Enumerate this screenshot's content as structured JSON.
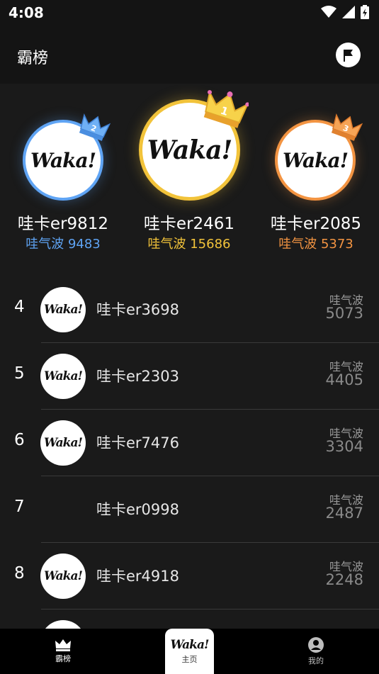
{
  "status_bar": {
    "time": "4:08"
  },
  "header": {
    "title": "霸榜"
  },
  "logo_text": "Waka!",
  "top3": [
    {
      "rank": "2",
      "name": "哇卡er9812",
      "score_text": "哇气波 9483",
      "color": "#5fa4f4"
    },
    {
      "rank": "1",
      "name": "哇卡er2461",
      "score_text": "哇气波 15686",
      "color": "#f2c33a"
    },
    {
      "rank": "3",
      "name": "哇卡er2085",
      "score_text": "哇气波 5373",
      "color": "#f39442"
    }
  ],
  "rows": [
    {
      "rank": "4",
      "name": "哇卡er3698",
      "score_label": "哇气波",
      "score": "5073"
    },
    {
      "rank": "5",
      "name": "哇卡er2303",
      "score_label": "哇气波",
      "score": "4405"
    },
    {
      "rank": "6",
      "name": "哇卡er7476",
      "score_label": "哇气波",
      "score": "3304"
    },
    {
      "rank": "7",
      "name": "哇卡er0998",
      "score_label": "哇气波",
      "score": "2487"
    },
    {
      "rank": "8",
      "name": "哇卡er4918",
      "score_label": "哇气波",
      "score": "2248"
    }
  ],
  "tabs": {
    "rank": "霸榜",
    "home": "主页",
    "mine": "我的"
  }
}
